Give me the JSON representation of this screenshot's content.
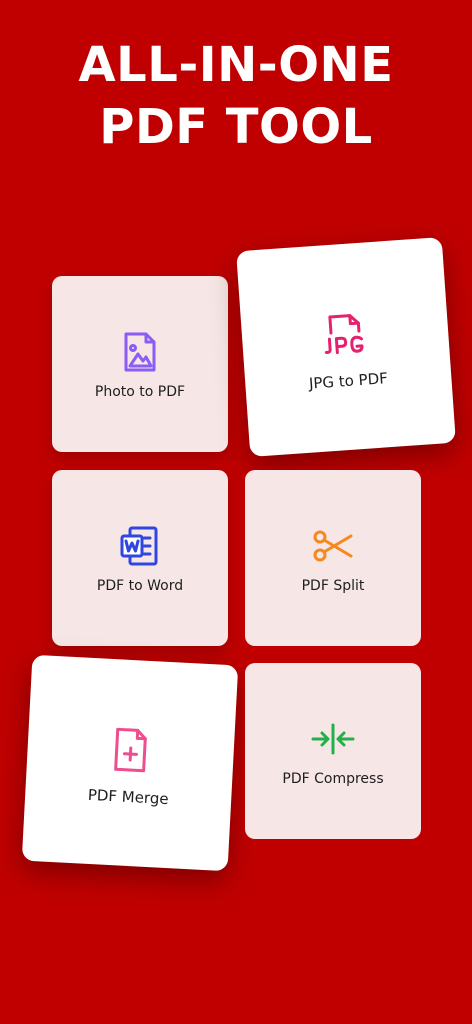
{
  "header": {
    "line1": "ALL-IN-ONE",
    "line2": "PDF TOOL"
  },
  "tools": [
    {
      "label": "Photo to PDF",
      "icon": "image-file-icon",
      "color": "#8b5cf6"
    },
    {
      "label": "JPG to PDF",
      "icon": "jpg-file-icon",
      "color": "#e6206e"
    },
    {
      "label": "PDF to Word",
      "icon": "word-icon",
      "color": "#2f47e0"
    },
    {
      "label": "PDF Split",
      "icon": "scissors-icon",
      "color": "#f5891f"
    },
    {
      "label": "PDF Merge",
      "icon": "add-file-icon",
      "color": "#ee4d90"
    },
    {
      "label": "PDF Compress",
      "icon": "compress-icon",
      "color": "#22b04b"
    }
  ],
  "colors": {
    "background": "#c00000",
    "card": "#f6e6e6",
    "card_highlight": "#ffffff"
  }
}
